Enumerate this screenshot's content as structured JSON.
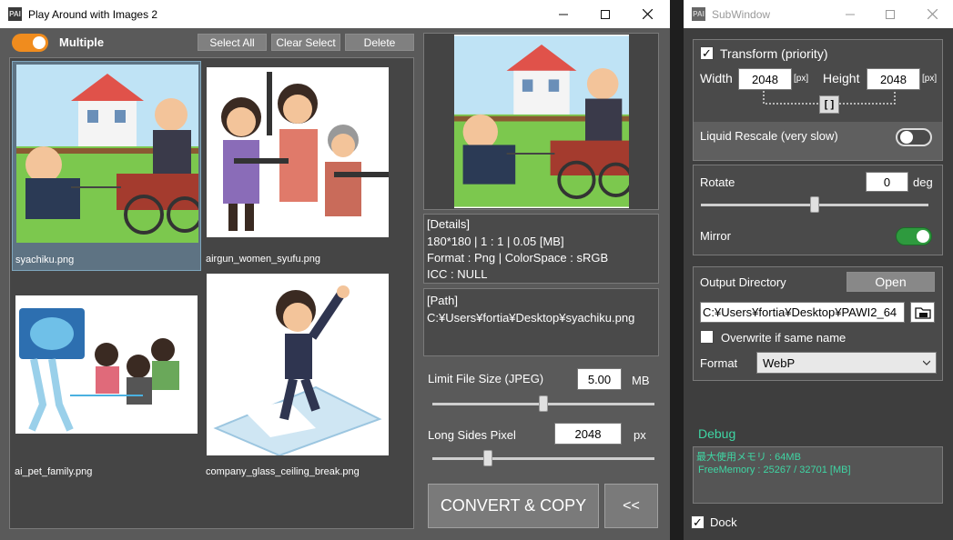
{
  "main": {
    "title": "Play Around with Images 2",
    "icon_text": "PAI",
    "toggle_label": "Multiple",
    "toolbar": {
      "select_all": "Select All",
      "clear_select": "Clear Select",
      "delete": "Delete"
    },
    "thumbnails": [
      {
        "name": "syachiku.png",
        "selected": true
      },
      {
        "name": "airgun_women_syufu.png",
        "selected": false
      },
      {
        "name": "ai_pet_family.png",
        "selected": false
      },
      {
        "name": "company_glass_ceiling_break.png",
        "selected": false
      }
    ],
    "details": {
      "header": "[Details]",
      "line1": "180*180 | 1 : 1  |  0.05 [MB]",
      "line2": "Format : Png | ColorSpace : sRGB",
      "line3": "ICC : NULL"
    },
    "path": {
      "header": "[Path]",
      "value": "C:¥Users¥fortia¥Desktop¥syachiku.png"
    },
    "limit": {
      "label": "Limit File Size (JPEG)",
      "value": "5.00",
      "unit": "MB",
      "level": 0.5
    },
    "long_side": {
      "label": "Long Sides Pixel",
      "value": "2048",
      "unit": "px",
      "level": 0.25
    },
    "convert_label": "CONVERT & COPY",
    "collapse_label": "<<"
  },
  "sub": {
    "title": "SubWindow",
    "icon_text": "PAI",
    "transform": {
      "checked": true,
      "label": "Transform (priority)",
      "width_label": "Width",
      "width_value": "2048",
      "px1": "[px]",
      "height_label": "Height",
      "height_value": "2048",
      "px2": "[px]",
      "link_label": "[ ]"
    },
    "liquid_label": "Liquid Rescale (very slow)",
    "rotate": {
      "label": "Rotate",
      "value": "0",
      "unit": "deg",
      "level": 0.5
    },
    "mirror_label": "Mirror",
    "output": {
      "label": "Output Directory",
      "open_label": "Open",
      "path_value": "C:¥Users¥fortia¥Desktop¥PAWI2_64",
      "overwrite_label": "Overwrite if same name",
      "format_label": "Format",
      "format_value": "WebP"
    },
    "debug": {
      "label": "Debug",
      "line1": "最大使用メモリ : 64MB",
      "line2": "FreeMemory : 25267 / 32701 [MB]"
    },
    "dock_label": "Dock"
  },
  "colors": {
    "accent_orange": "#f08c1e",
    "toggle_green": "#2e9a3e",
    "debug_text": "#3fd6a4",
    "selection": "#5e7383"
  }
}
